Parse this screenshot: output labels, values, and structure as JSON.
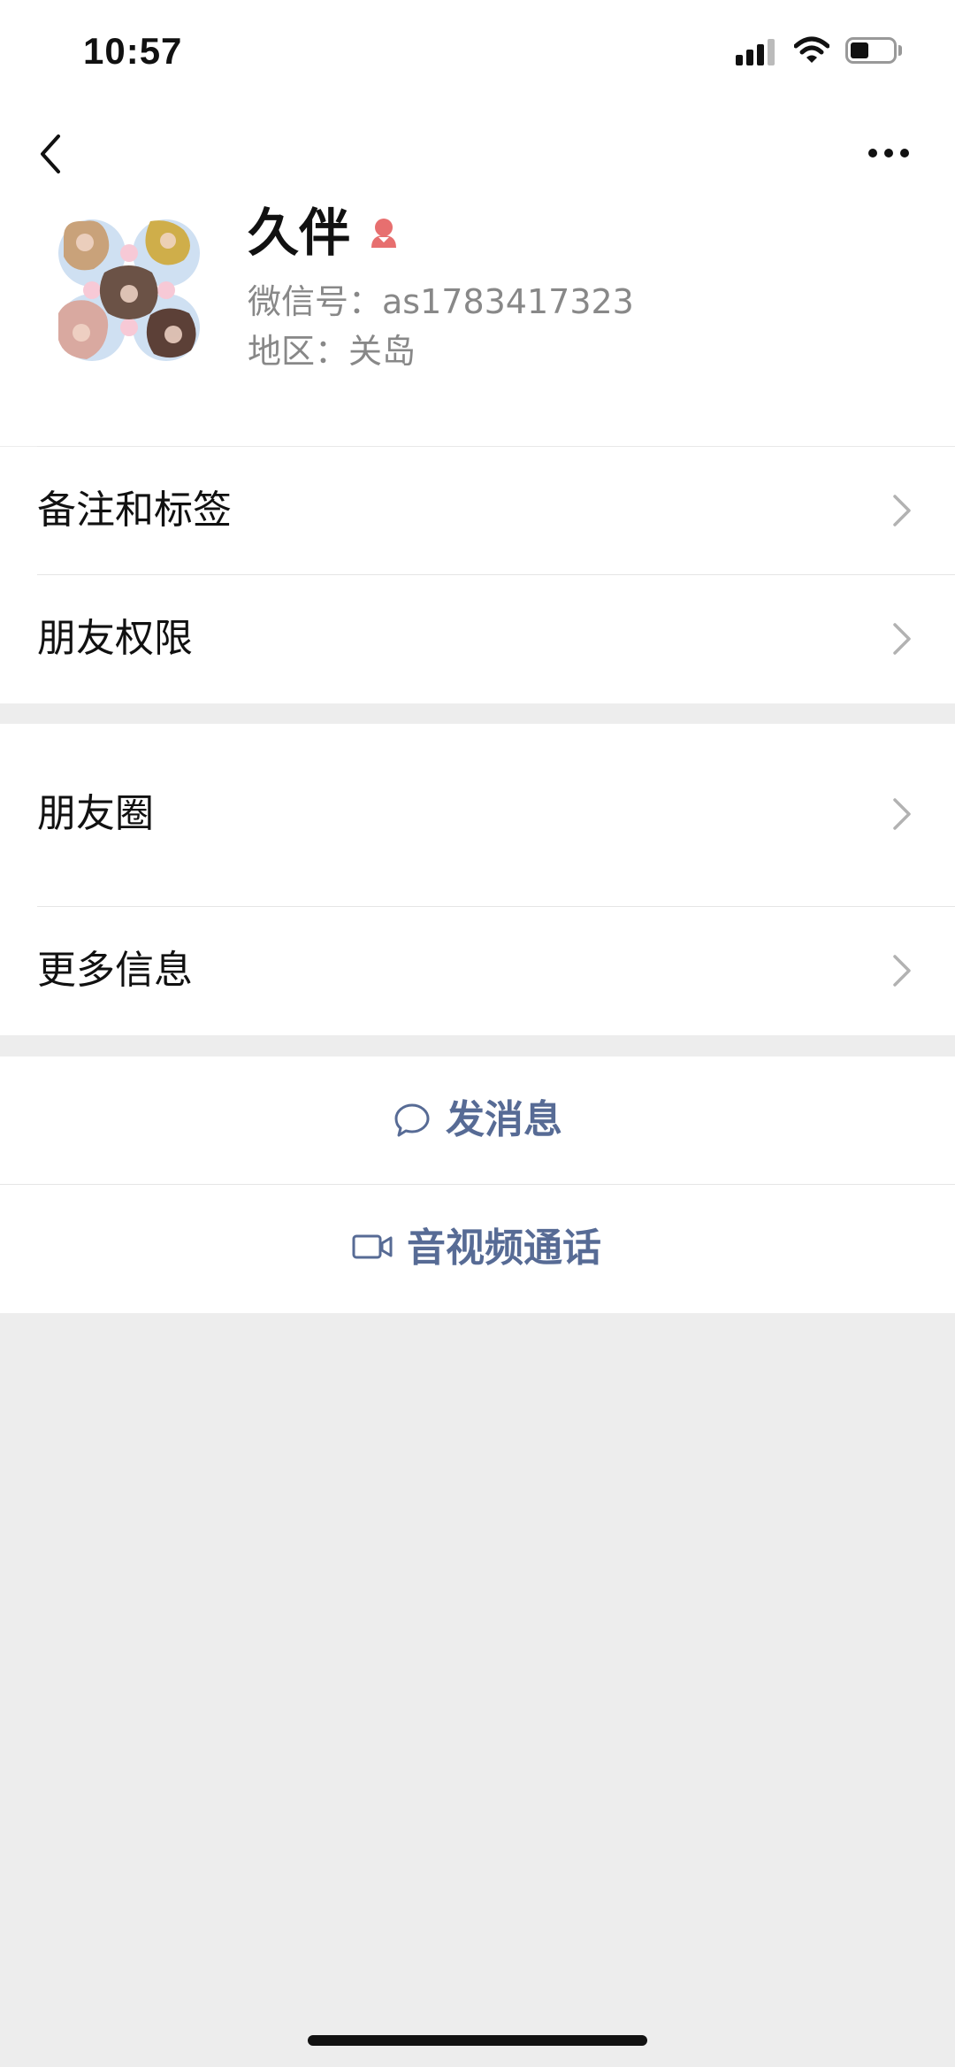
{
  "status_bar": {
    "time": "10:57"
  },
  "profile": {
    "name": "久伴",
    "wechat_id": "微信号：as1783417323",
    "region": "地区：关岛",
    "gender": "female"
  },
  "menu": {
    "group1": [
      {
        "label": "备注和标签"
      },
      {
        "label": "朋友权限"
      }
    ],
    "group2": [
      {
        "label": "朋友圈"
      },
      {
        "label": "更多信息"
      }
    ]
  },
  "actions": {
    "message": "发消息",
    "video_call": "音视频通话"
  },
  "colors": {
    "background": "#ededed",
    "surface": "#ffffff",
    "link": "#576b95",
    "secondary_text": "#888888",
    "gender_female": "#e76f6f"
  },
  "icons": {
    "back": "chevron-left-icon",
    "more": "more-dots-icon",
    "gender": "female-gender-icon",
    "chevron": "chevron-right-icon",
    "message": "chat-bubble-icon",
    "video": "video-camera-icon"
  }
}
